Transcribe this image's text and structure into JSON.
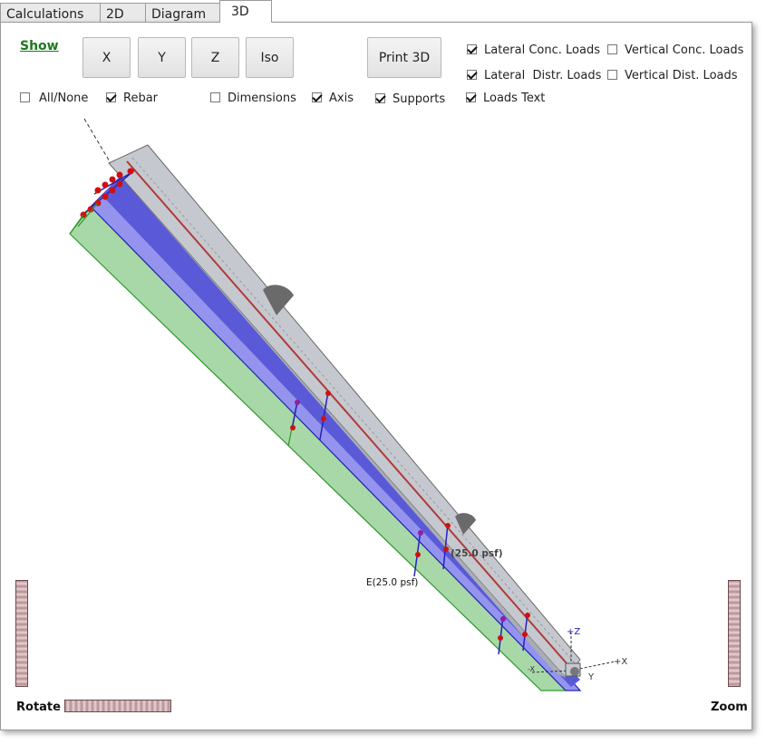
{
  "tabs": [
    {
      "label": "Calculations"
    },
    {
      "label": "2D"
    },
    {
      "label": "Diagram"
    },
    {
      "label": "3D"
    }
  ],
  "toolbar": {
    "show_label": "Show",
    "view_buttons": {
      "x": "X",
      "y": "Y",
      "z": "Z",
      "iso": "Iso"
    },
    "print_label": "Print 3D"
  },
  "options": {
    "all_none": {
      "label": "All/None",
      "checked": false
    },
    "rebar": {
      "label": "Rebar",
      "checked": true
    },
    "dimensions": {
      "label": "Dimensions",
      "checked": false
    },
    "axis": {
      "label": "Axis",
      "checked": true
    },
    "supports": {
      "label": "Supports",
      "checked": true
    },
    "lateral_conc": {
      "label": "Lateral Conc. Loads",
      "checked": true
    },
    "lateral_distr": {
      "label": "Lateral  Distr. Loads",
      "checked": true
    },
    "loads_text": {
      "label": "Loads Text",
      "checked": true
    },
    "vertical_conc": {
      "label": "Vertical Conc. Loads",
      "checked": false
    },
    "vertical_dist": {
      "label": "Vertical Dist. Loads",
      "checked": false
    }
  },
  "viewport": {
    "load_label_1": "E(25.0 psf)",
    "load_label_2": "(25.0 psf)",
    "axis_z": "+Z",
    "axis_x": "+X",
    "axis_y": "Y",
    "axis_negx": "-X"
  },
  "controls": {
    "rotate_label": "Rotate",
    "zoom_label": "Zoom"
  },
  "colors": {
    "green_face": "#a8d8a8",
    "blue_face": "#8f8ff0",
    "beam_grey": "#c4c8ce",
    "rebar_red": "#b04040"
  }
}
